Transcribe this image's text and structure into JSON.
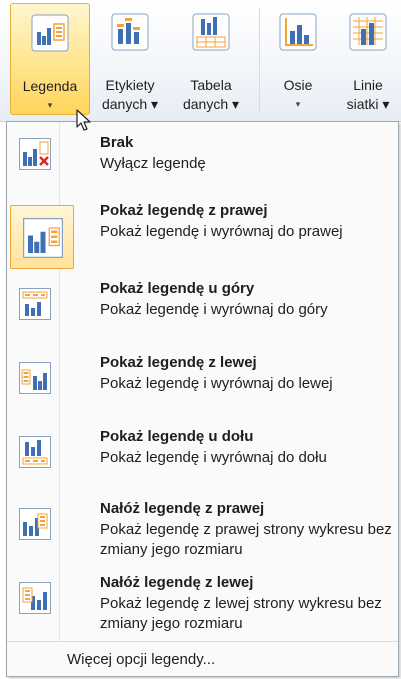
{
  "ribbon": {
    "buttons": [
      {
        "line1": "Legenda",
        "line2": "▾"
      },
      {
        "line1": "Etykiety",
        "line2": "danych ▾"
      },
      {
        "line1": "Tabela",
        "line2": "danych ▾"
      },
      {
        "line1": "Osie",
        "line2": "▾"
      },
      {
        "line1": "Linie",
        "line2": "siatki ▾"
      }
    ]
  },
  "menu": {
    "items": [
      {
        "title": "Brak",
        "desc": "Wyłącz legendę",
        "icon": "legend-none-icon"
      },
      {
        "title": "Pokaż legendę z prawej",
        "desc": "Pokaż legendę i wyrównaj do prawej",
        "icon": "legend-right-icon",
        "selected": true
      },
      {
        "title": "Pokaż legendę u góry",
        "desc": "Pokaż legendę i wyrównaj do góry",
        "icon": "legend-top-icon"
      },
      {
        "title": "Pokaż legendę z lewej",
        "desc": "Pokaż legendę i wyrównaj do lewej",
        "icon": "legend-left-icon"
      },
      {
        "title": "Pokaż legendę u dołu",
        "desc": "Pokaż legendę i wyrównaj do dołu",
        "icon": "legend-bottom-icon"
      },
      {
        "title": "Nałóż legendę z prawej",
        "desc": "Pokaż legendę z prawej strony wykresu bez zmiany jego rozmiaru",
        "icon": "legend-overlay-right-icon"
      },
      {
        "title": "Nałóż legendę z lewej",
        "desc": "Pokaż legendę z lewej strony wykresu bez zmiany jego rozmiaru",
        "icon": "legend-overlay-left-icon"
      }
    ],
    "more_label": "Więcej opcji legendy..."
  },
  "colors": {
    "active_fill": "#ffe58e",
    "active_border": "#e3b23c",
    "chart_blue": "#3f6fb5",
    "legend_orange": "#f5a23a",
    "delete_red": "#d9262e"
  }
}
